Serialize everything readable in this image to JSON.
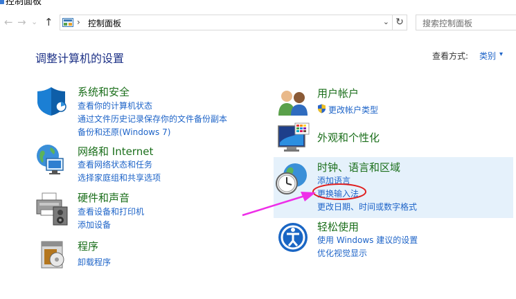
{
  "window": {
    "title": "控制面板"
  },
  "nav": {
    "back": "←",
    "forward": "→",
    "dropdown": "⌄",
    "up": "↑",
    "breadcrumb_sep": "›",
    "breadcrumb": "控制面板",
    "address_dropdown": "⌄",
    "refresh": "↻",
    "search_placeholder": "搜索控制面板"
  },
  "header": {
    "title": "调整计算机的设置",
    "view_by_label": "查看方式:",
    "view_by_value": "类别",
    "view_by_dropdown": "▾"
  },
  "categories_left": [
    {
      "title": "系统和安全",
      "links": [
        "查看你的计算机状态",
        "通过文件历史记录保存你的文件备份副本",
        "备份和还原(Windows 7)"
      ]
    },
    {
      "title": "网络和 Internet",
      "links": [
        "查看网络状态和任务",
        "选择家庭组和共享选项"
      ]
    },
    {
      "title": "硬件和声音",
      "links": [
        "查看设备和打印机",
        "添加设备"
      ]
    },
    {
      "title": "程序",
      "links": [
        "卸载程序"
      ]
    }
  ],
  "categories_right": [
    {
      "title": "用户帐户",
      "links": [
        "更改帐户类型"
      ]
    },
    {
      "title": "外观和个性化",
      "links": []
    },
    {
      "title": "时钟、语言和区域",
      "links": [
        "添加语言",
        "更换输入法",
        "更改日期、时间或数字格式"
      ]
    },
    {
      "title": "轻松使用",
      "links": [
        "使用 Windows 建议的设置",
        "优化视觉显示"
      ]
    }
  ],
  "annotation": {
    "color": "#ee2ee8",
    "ring_color": "#e02020"
  }
}
